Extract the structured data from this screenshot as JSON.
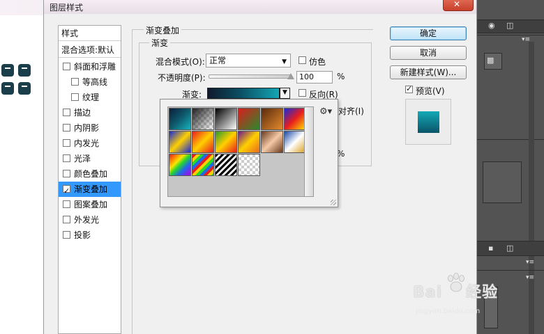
{
  "window": {
    "title": "图层样式"
  },
  "styles_list": {
    "header": "样式",
    "blend_default": "混合选项:默认",
    "items": [
      {
        "label": "斜面和浮雕",
        "checked": false,
        "indent": false
      },
      {
        "label": "等高线",
        "checked": false,
        "indent": true
      },
      {
        "label": "纹理",
        "checked": false,
        "indent": true
      },
      {
        "label": "描边",
        "checked": false,
        "indent": false
      },
      {
        "label": "内阴影",
        "checked": false,
        "indent": false
      },
      {
        "label": "内发光",
        "checked": false,
        "indent": false
      },
      {
        "label": "光泽",
        "checked": false,
        "indent": false
      },
      {
        "label": "颜色叠加",
        "checked": false,
        "indent": false
      },
      {
        "label": "渐变叠加",
        "checked": true,
        "indent": false,
        "selected": true
      },
      {
        "label": "图案叠加",
        "checked": false,
        "indent": false
      },
      {
        "label": "外发光",
        "checked": false,
        "indent": false
      },
      {
        "label": "投影",
        "checked": false,
        "indent": false
      }
    ]
  },
  "section": {
    "title": "渐变叠加",
    "subtitle": "渐变",
    "blend_mode_label": "混合模式(O):",
    "blend_mode_value": "正常",
    "dither_label": "仿色",
    "opacity_label": "不透明度(P):",
    "opacity_value": "100",
    "opacity_unit": "%",
    "opacity_fraction": 1.0,
    "gradient_label": "渐变:",
    "reverse_label": "反向(R)",
    "align_label_partial": "对齐(I)",
    "scale_unit_partial": "%"
  },
  "buttons": {
    "ok": "确定",
    "cancel": "取消",
    "new_style": "新建样式(W)...",
    "preview_label": "预览(V)",
    "preview_checked": true
  },
  "gradient_presets": [
    {
      "id": "p1",
      "css": "linear-gradient(135deg,#0a1d3a 0%,#0e5a6d 50%,#16b3bd 100%)"
    },
    {
      "id": "p2",
      "css": "checker-fg"
    },
    {
      "id": "p3",
      "css": "linear-gradient(135deg,#000 0%,#ffffff 100%)"
    },
    {
      "id": "p4",
      "css": "linear-gradient(135deg,#d81e1e 0%,#2a8a2a 100%)"
    },
    {
      "id": "p5",
      "css": "linear-gradient(135deg,#5b2a0c 0%,#e38a2d 100%)"
    },
    {
      "id": "p6",
      "css": "linear-gradient(135deg,#1a2ad8 0%,#e81e1e 50%,#ffe400 100%)"
    },
    {
      "id": "p7",
      "css": "linear-gradient(135deg,#1a2ad8 0%,#ffd000 50%,#1a2ad8 100%)"
    },
    {
      "id": "p8",
      "css": "linear-gradient(135deg,#e81e1e 0%,#ffd000 50%,#e81e1e 100%)"
    },
    {
      "id": "p9",
      "css": "linear-gradient(135deg,#2a9a2a 0%,#ffd000 50%,#e81e1e 100%)"
    },
    {
      "id": "p10",
      "css": "linear-gradient(135deg,#6a1a8a 0%,#ffd000 50%,#e86a1e 100%)"
    },
    {
      "id": "p11",
      "css": "linear-gradient(135deg,#6a3a1e 0%,#f4c9a6 50%,#6a3a1e 100%)"
    },
    {
      "id": "p12",
      "css": "linear-gradient(135deg,#1a4aa8 0%,#ffffff 50%,#d8a01e 100%)"
    },
    {
      "id": "p13",
      "css": "linear-gradient(135deg,#e81e1e 0%,#ff8a00 20%,#ffe400 35%,#2ad82a 50%,#1e6ae8 70%,#8a1ee8 90%)"
    },
    {
      "id": "p14",
      "css": "repeating-linear-gradient(135deg,#e81e1e 0 4px,#ffd000 4px 8px,#2ad82a 8px 12px,#1e6ae8 12px 16px)"
    },
    {
      "id": "p15",
      "css": "repeating-linear-gradient(135deg,#000 0 3px,#ffffff 3px 6px)"
    },
    {
      "id": "p16",
      "css": "checker"
    }
  ],
  "watermark": {
    "brand_a": "Bai",
    "brand_b": "经验",
    "url": "jingyan.baidu.com"
  },
  "colors": {
    "accent_selected": "#3399ff",
    "gradient_start": "#101a2c",
    "gradient_end": "#13a6b4"
  }
}
